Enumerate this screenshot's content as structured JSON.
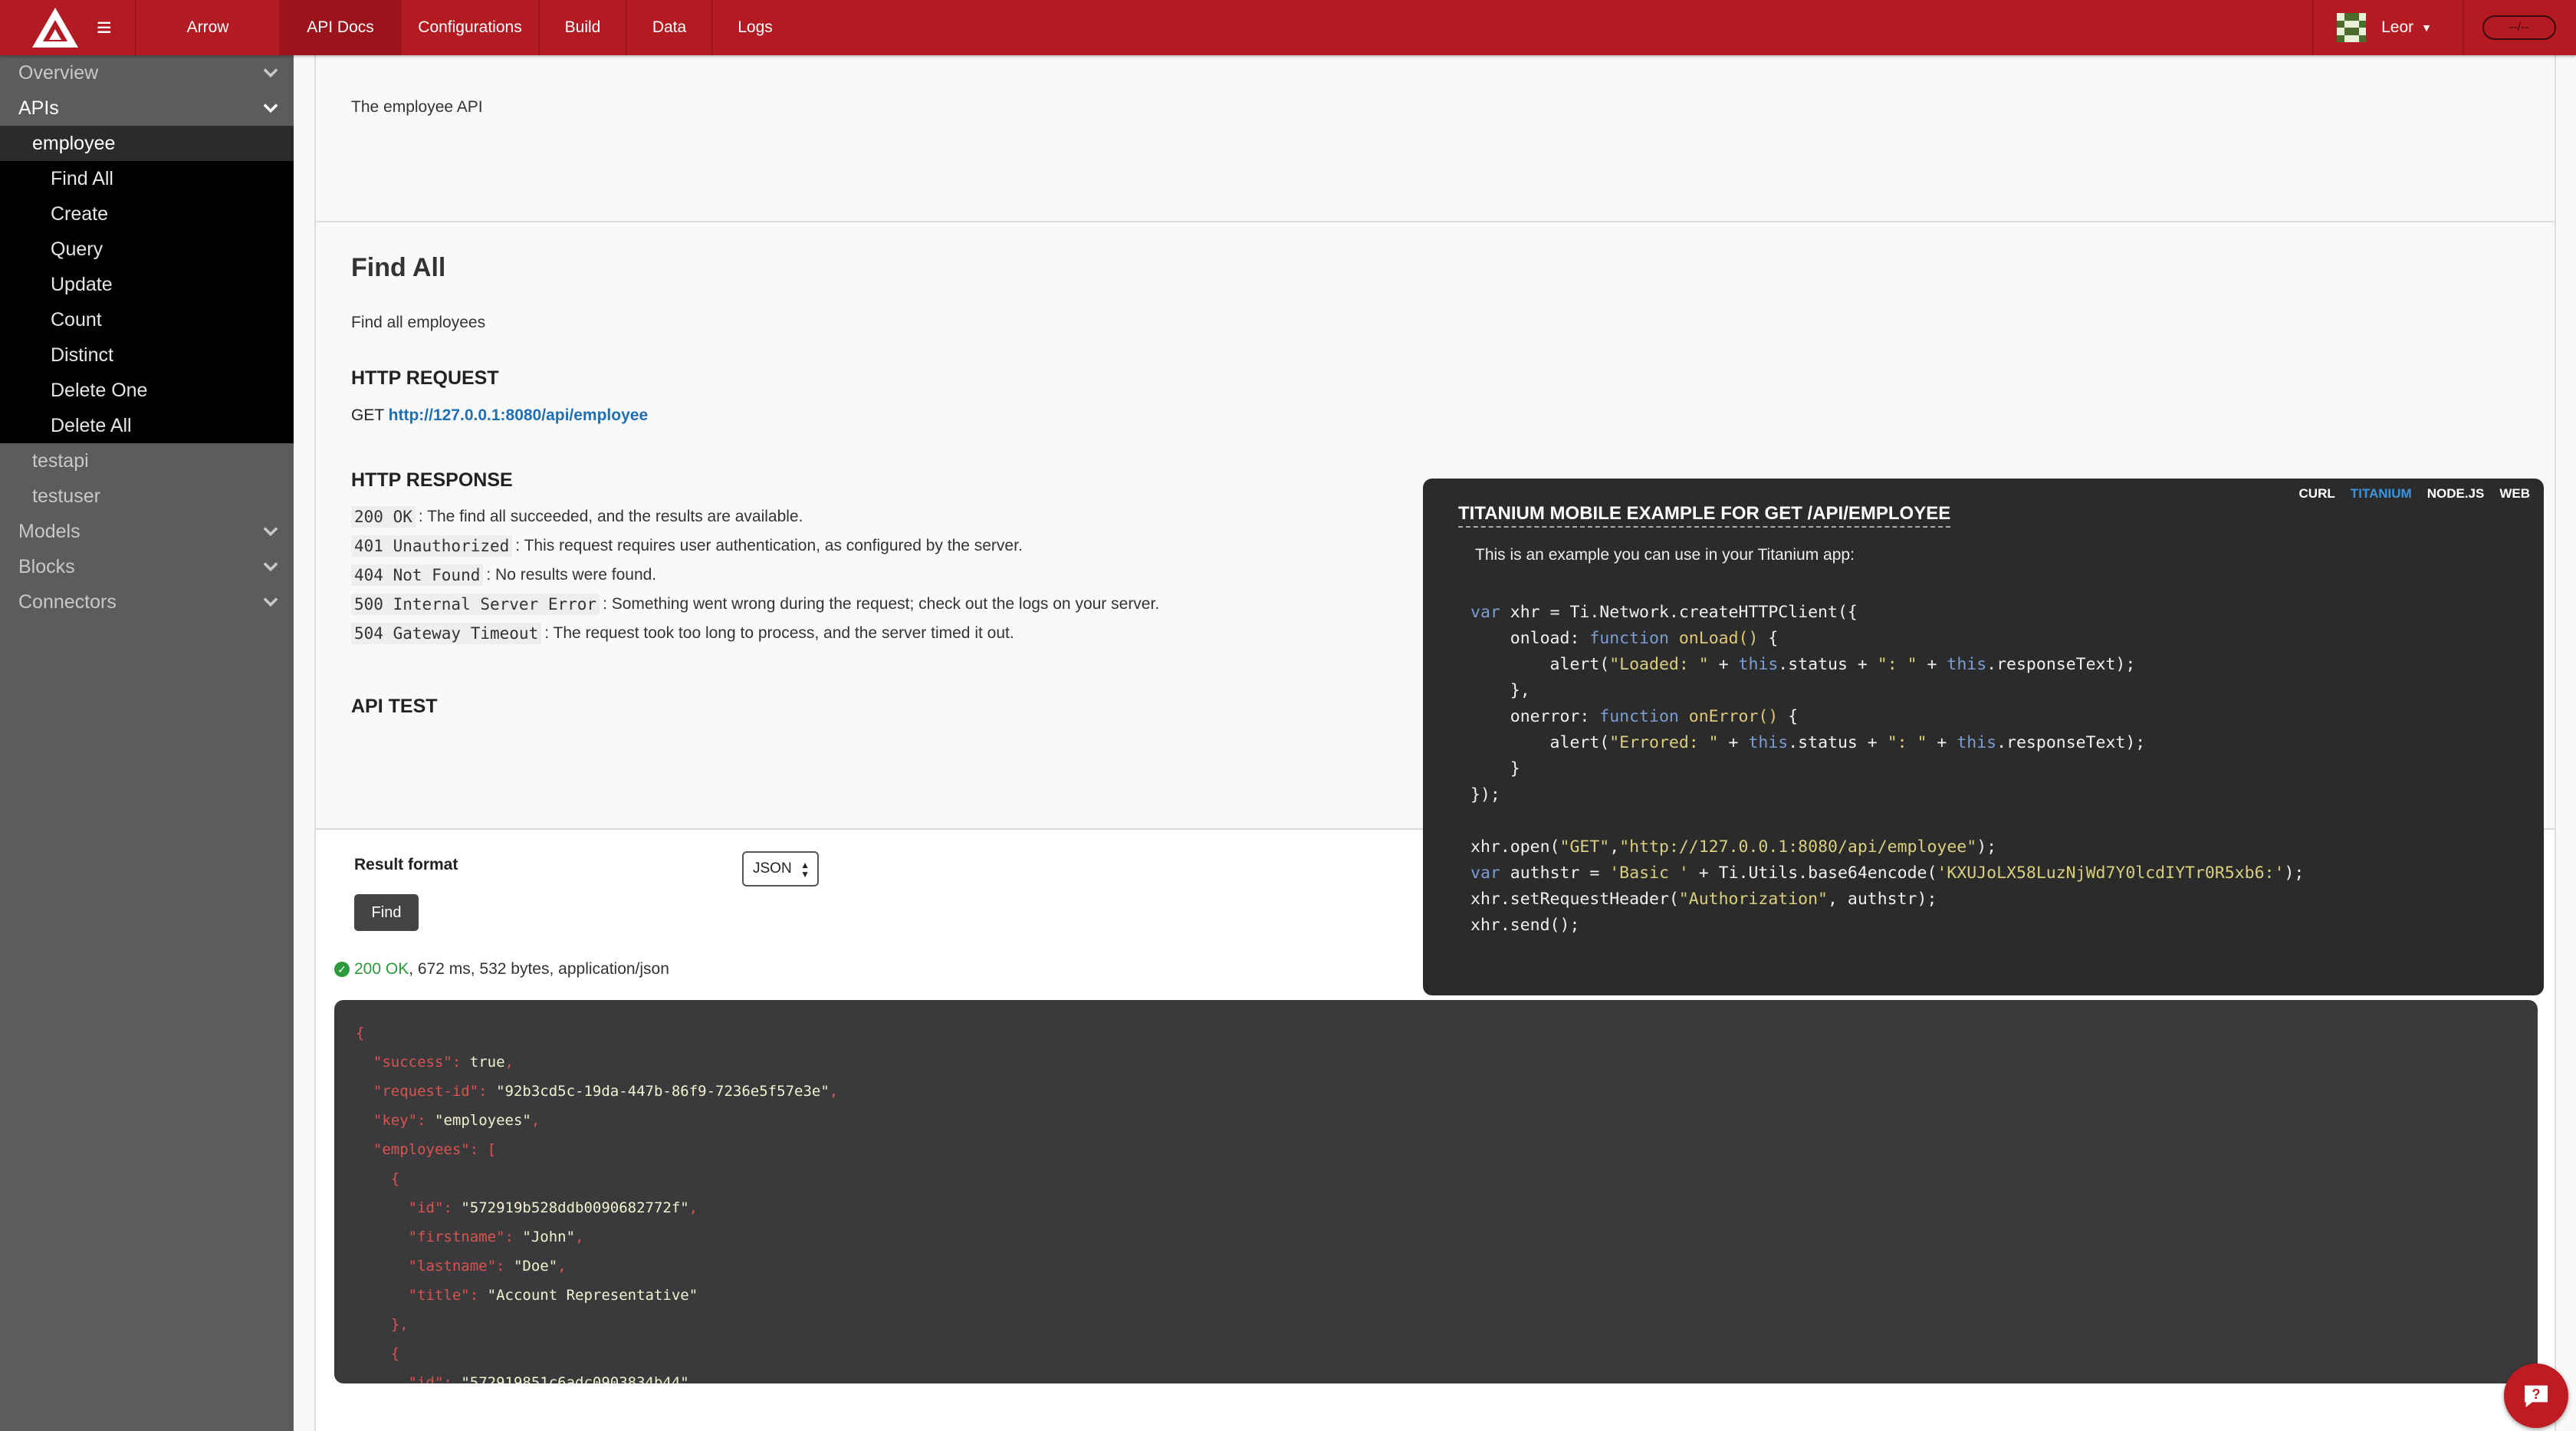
{
  "topbar": {
    "nav": [
      "Arrow",
      "API Docs",
      "Configurations",
      "Build",
      "Data",
      "Logs"
    ],
    "active_nav": "API Docs",
    "user_name": "Leor",
    "pill_text": "--/--"
  },
  "sidebar": {
    "overview": "Overview",
    "apis": "APIs",
    "employee": "employee",
    "employee_items": [
      "Find All",
      "Create",
      "Query",
      "Update",
      "Count",
      "Distinct",
      "Delete One",
      "Delete All"
    ],
    "testapi": "testapi",
    "testuser": "testuser",
    "models": "Models",
    "blocks": "Blocks",
    "connectors": "Connectors"
  },
  "intro": {
    "text": "The employee API"
  },
  "endpoint": {
    "title": "Find All",
    "description": "Find all employees",
    "http_request_label": "HTTP REQUEST",
    "method": "GET",
    "url": "http://127.0.0.1:8080/api/employee",
    "http_response_label": "HTTP RESPONSE",
    "responses": [
      {
        "code": "200 OK",
        "text": ": The find all succeeded, and the results are available."
      },
      {
        "code": "401 Unauthorized",
        "text": ": This request requires user authentication, as configured by the server."
      },
      {
        "code": "404 Not Found",
        "text": ": No results were found."
      },
      {
        "code": "500 Internal Server Error",
        "text": ": Something went wrong during the request; check out the logs on your server."
      },
      {
        "code": "504 Gateway Timeout",
        "text": ": The request took too long to process, and the server timed it out."
      }
    ],
    "api_test_label": "API TEST"
  },
  "example": {
    "tabs": [
      "CURL",
      "TITANIUM",
      "NODE.JS",
      "WEB"
    ],
    "active_tab": "TITANIUM",
    "title": "TITANIUM MOBILE EXAMPLE FOR GET /API/EMPLOYEE",
    "note": "This is an example you can use in your Titanium app:"
  },
  "test": {
    "result_format_label": "Result format",
    "format_value": "JSON",
    "find_label": "Find",
    "status_ok": "200 OK",
    "status_rest": ", 672 ms, 532 bytes, application/json"
  }
}
